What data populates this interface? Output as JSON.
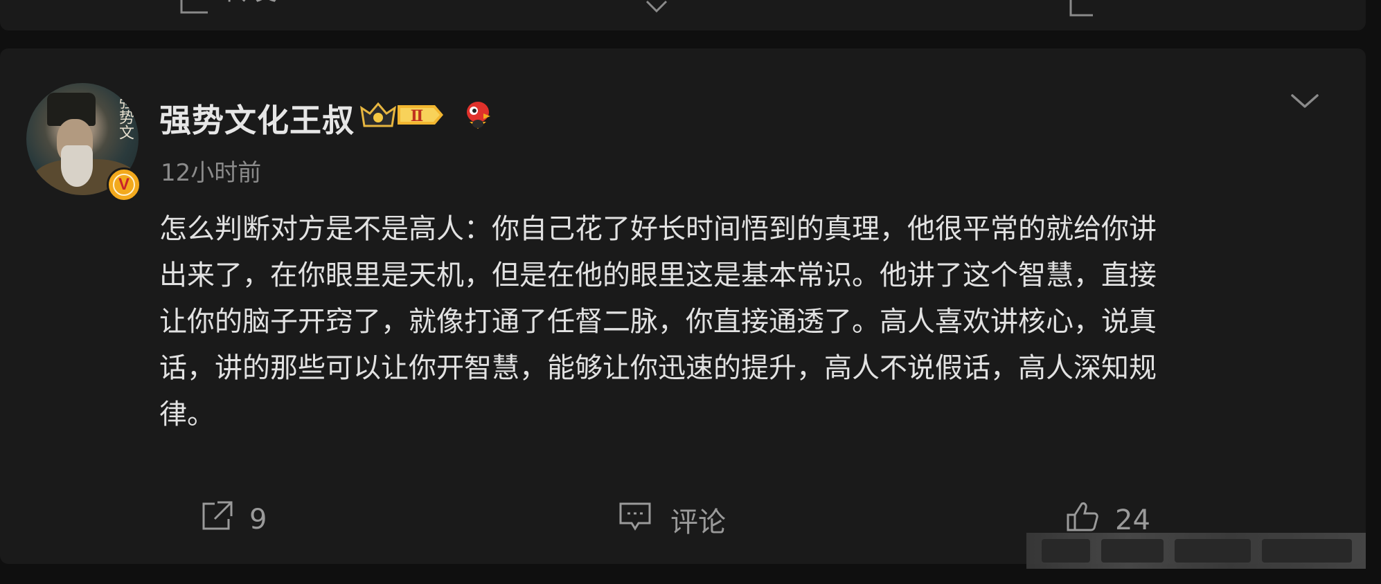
{
  "prev_card": {
    "actions": [
      {
        "icon": "share-icon",
        "label": "转发"
      },
      {
        "icon": "comment-icon",
        "label": ""
      },
      {
        "icon": "like-icon",
        "label": ""
      }
    ]
  },
  "post": {
    "author": {
      "name": "强势文化王叔",
      "avatar_text": "强势文",
      "verified_badge": "V",
      "member_badge_icon": "crown-member-icon",
      "member_level": "Ⅱ",
      "mascot_icon": "weibo-mascot-icon"
    },
    "timestamp": "12小时前",
    "text": "怎么判断对方是不是高人：你自己花了好长时间悟到的真理，他很平常的就给你讲\n出来了，在你眼里是天机，但是在他的眼里这是基本常识。他讲了这个智慧，直接\n让你的脑子开窍了，就像打通了任督二脉，你直接通透了。高人喜欢讲核心，说真\n话，讲的那些可以让你开智慧，能够让你迅速的提升，高人不说假话，高人深知规\n律。",
    "actions": {
      "repost": {
        "icon": "share-icon",
        "label": "9"
      },
      "comment": {
        "icon": "comment-icon",
        "label": "评论"
      },
      "like": {
        "icon": "like-icon",
        "label": "24"
      }
    }
  },
  "colors": {
    "background": "#0f0f0f",
    "card": "#1a1a1a",
    "text": "#e2e2e2",
    "muted": "#8b8b8b",
    "badge_gold": "#f2a91d"
  }
}
